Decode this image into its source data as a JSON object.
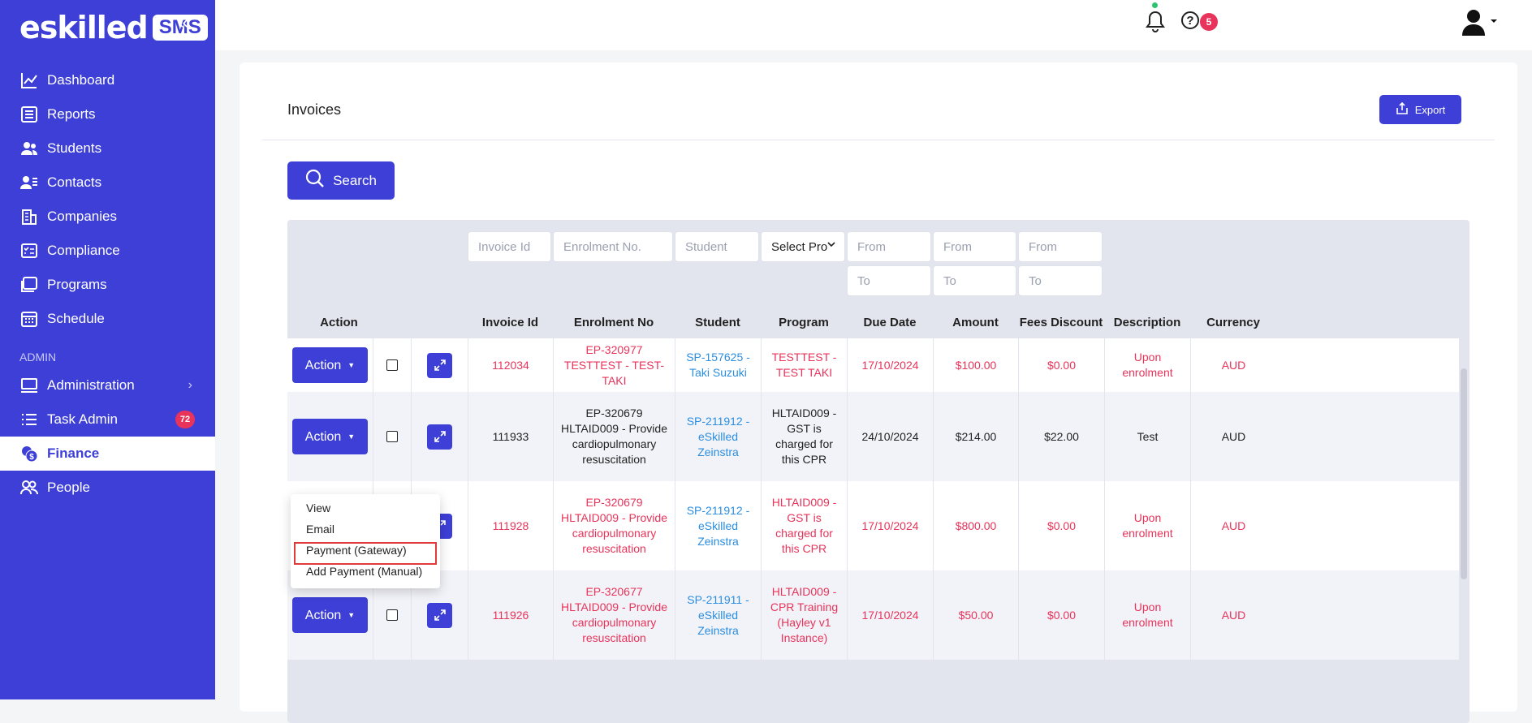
{
  "brand": {
    "logo": "eskilled",
    "badge": "SMS"
  },
  "sidebar": {
    "items": [
      {
        "label": "Dashboard",
        "icon": "chart-line-icon"
      },
      {
        "label": "Reports",
        "icon": "report-list-icon"
      },
      {
        "label": "Students",
        "icon": "users-icon"
      },
      {
        "label": "Contacts",
        "icon": "contact-card-icon"
      },
      {
        "label": "Companies",
        "icon": "building-icon"
      },
      {
        "label": "Compliance",
        "icon": "checklist-icon"
      },
      {
        "label": "Programs",
        "icon": "folders-icon"
      },
      {
        "label": "Schedule",
        "icon": "calendar-icon"
      }
    ],
    "section": "ADMIN",
    "admin_items": [
      {
        "label": "Administration",
        "icon": "monitor-icon"
      },
      {
        "label": "Task Admin",
        "icon": "task-list-icon",
        "badge": "72"
      },
      {
        "label": "Finance",
        "icon": "finance-coins-icon",
        "active": true
      },
      {
        "label": "People",
        "icon": "people-icon"
      }
    ]
  },
  "topbar": {
    "help_badge": "5"
  },
  "page": {
    "title": "Invoices",
    "export_label": "Export",
    "search_label": "Search"
  },
  "filters": {
    "invoice_id": "Invoice Id",
    "enrolment_no": "Enrolment No.",
    "student": "Student",
    "program": "Select Pro",
    "due_from": "From",
    "due_to": "To",
    "amount_from": "From",
    "amount_to": "To",
    "fees_from": "From",
    "fees_to": "To"
  },
  "headers": {
    "action": "Action",
    "invoice_id": "Invoice Id",
    "enrolment_no": "Enrolment No",
    "student": "Student",
    "program": "Program",
    "due_date": "Due Date",
    "amount": "Amount",
    "fees_discount": "Fees Discount",
    "description": "Description",
    "currency": "Currency"
  },
  "action_label": "Action",
  "rows": [
    {
      "invoice_id": "112034",
      "enrolment": "EP-320977 TESTTEST - TEST-TAKI",
      "student": "SP-157625 - Taki Suzuki",
      "program": "TESTTEST - TEST TAKI",
      "due_date": "17/10/2024",
      "amount": "$100.00",
      "fees_discount": "$0.00",
      "description": "Upon enrolment",
      "currency": "AUD"
    },
    {
      "invoice_id": "111933",
      "enrolment": "EP-320679 HLTAID009 - Provide cardiopulmonary resuscitation",
      "student": "SP-211912 - eSkilled Zeinstra",
      "program": "HLTAID009 - GST is charged for this CPR",
      "due_date": "24/10/2024",
      "amount": "$214.00",
      "fees_discount": "$22.00",
      "description": "Test",
      "currency": "AUD"
    },
    {
      "invoice_id": "111928",
      "enrolment": "EP-320679 HLTAID009 - Provide cardiopulmonary resuscitation",
      "student": "SP-211912 - eSkilled Zeinstra",
      "program": "HLTAID009 - GST is charged for this CPR",
      "due_date": "17/10/2024",
      "amount": "$800.00",
      "fees_discount": "$0.00",
      "description": "Upon enrolment",
      "currency": "AUD"
    },
    {
      "invoice_id": "111926",
      "enrolment": "EP-320677 HLTAID009 - Provide cardiopulmonary resuscitation",
      "student": "SP-211911 - eSkilled Zeinstra",
      "program": "HLTAID009 - CPR Training (Hayley v1 Instance)",
      "due_date": "17/10/2024",
      "amount": "$50.00",
      "fees_discount": "$0.00",
      "description": "Upon enrolment",
      "currency": "AUD"
    }
  ],
  "dropdown": {
    "items": [
      "View",
      "Email",
      "Payment (Gateway)",
      "Add Payment (Manual)"
    ]
  },
  "colors": {
    "primary": "#3d3fd6",
    "danger": "#e8335a",
    "link": "#2b8ee0"
  }
}
